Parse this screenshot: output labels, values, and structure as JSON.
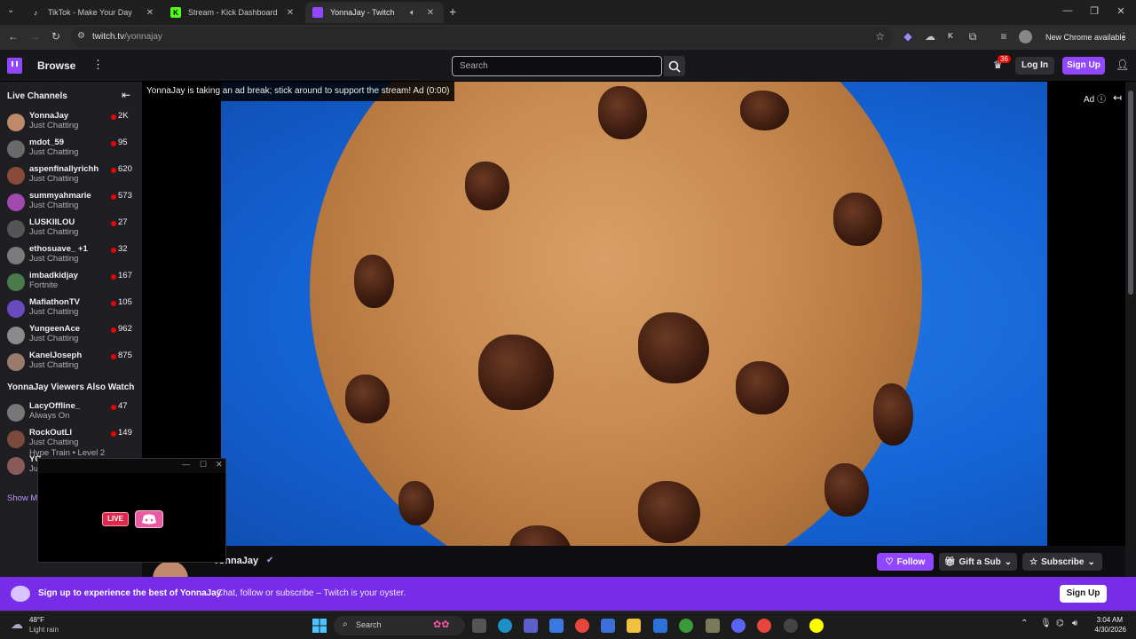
{
  "browser": {
    "tabs": [
      {
        "title": "TikTok - Make Your Day"
      },
      {
        "title": "Stream - Kick Dashboard"
      },
      {
        "title": "YonnaJay - Twitch"
      }
    ],
    "url_host": "twitch.tv",
    "url_path": "/yonnajay",
    "new_chrome_label": "New Chrome available"
  },
  "twitch": {
    "browse_label": "Browse",
    "search_placeholder": "Search",
    "notif_count": "36",
    "login_label": "Log In",
    "signup_label": "Sign Up",
    "live_channels_heading": "Live Channels",
    "also_watch_heading": "YonnaJay Viewers Also Watch",
    "show_more_label": "Show M",
    "live_channels": [
      {
        "name": "YonnaJay",
        "category": "Just Chatting",
        "viewers": "2K",
        "color": "#c08a6a"
      },
      {
        "name": "mdot_59",
        "category": "Just Chatting",
        "viewers": "95",
        "color": "#6a6a6a"
      },
      {
        "name": "aspenfinallyrichh",
        "category": "Just Chatting",
        "viewers": "620",
        "color": "#8a4a3a"
      },
      {
        "name": "summyahmarie",
        "category": "Just Chatting",
        "viewers": "573",
        "color": "#a04ab0"
      },
      {
        "name": "LUSKIILOU",
        "category": "Just Chatting",
        "viewers": "27",
        "color": "#555"
      },
      {
        "name": "ethosuave_ +1",
        "category": "Just Chatting",
        "viewers": "32",
        "color": "#7a7a7a"
      },
      {
        "name": "imbadkidjay",
        "category": "Fortnite",
        "viewers": "167",
        "color": "#4a7a4a"
      },
      {
        "name": "MafiathonTV",
        "category": "Just Chatting",
        "viewers": "105",
        "color": "#6a4ac0"
      },
      {
        "name": "YungeenAce",
        "category": "Just Chatting",
        "viewers": "962",
        "color": "#8a8a8a"
      },
      {
        "name": "KaneIJoseph",
        "category": "Just Chatting",
        "viewers": "875",
        "color": "#9a7a6a"
      }
    ],
    "also_watch": [
      {
        "name": "LacyOffline_",
        "category": "Always On",
        "viewers": "47",
        "color": "#777"
      },
      {
        "name": "RockOutLl",
        "category": "Just Chatting",
        "viewers": "149",
        "color": "#7a4a3a",
        "extra": "Hype Train • Level 2"
      },
      {
        "name": "YC",
        "category": "Ju",
        "viewers": "",
        "color": "#8a5a5a"
      }
    ],
    "ad_text": "YonnaJay is taking an ad break; stick around to support the stream! Ad (0:00)",
    "ad_label": "Ad",
    "channel_name": "YonnaJay",
    "follow_label": "Follow",
    "gift_label": "Gift a Sub",
    "subscribe_label": "Subscribe",
    "banner_title": "Sign up to experience the best of YonnaJay",
    "banner_sub": "Chat, follow or subscribe – Twitch is your oyster.",
    "banner_signup": "Sign Up"
  },
  "mini_window": {
    "live_label": "LIVE"
  },
  "taskbar": {
    "weather_temp": "48°F",
    "weather_desc": "Light rain",
    "search_label": "Search",
    "time": "3:04 AM",
    "date": "4/30/2026"
  },
  "colors": {
    "twitch_purple": "#9147ff",
    "live_red": "#eb0400",
    "video_blue": "#1565d8"
  }
}
